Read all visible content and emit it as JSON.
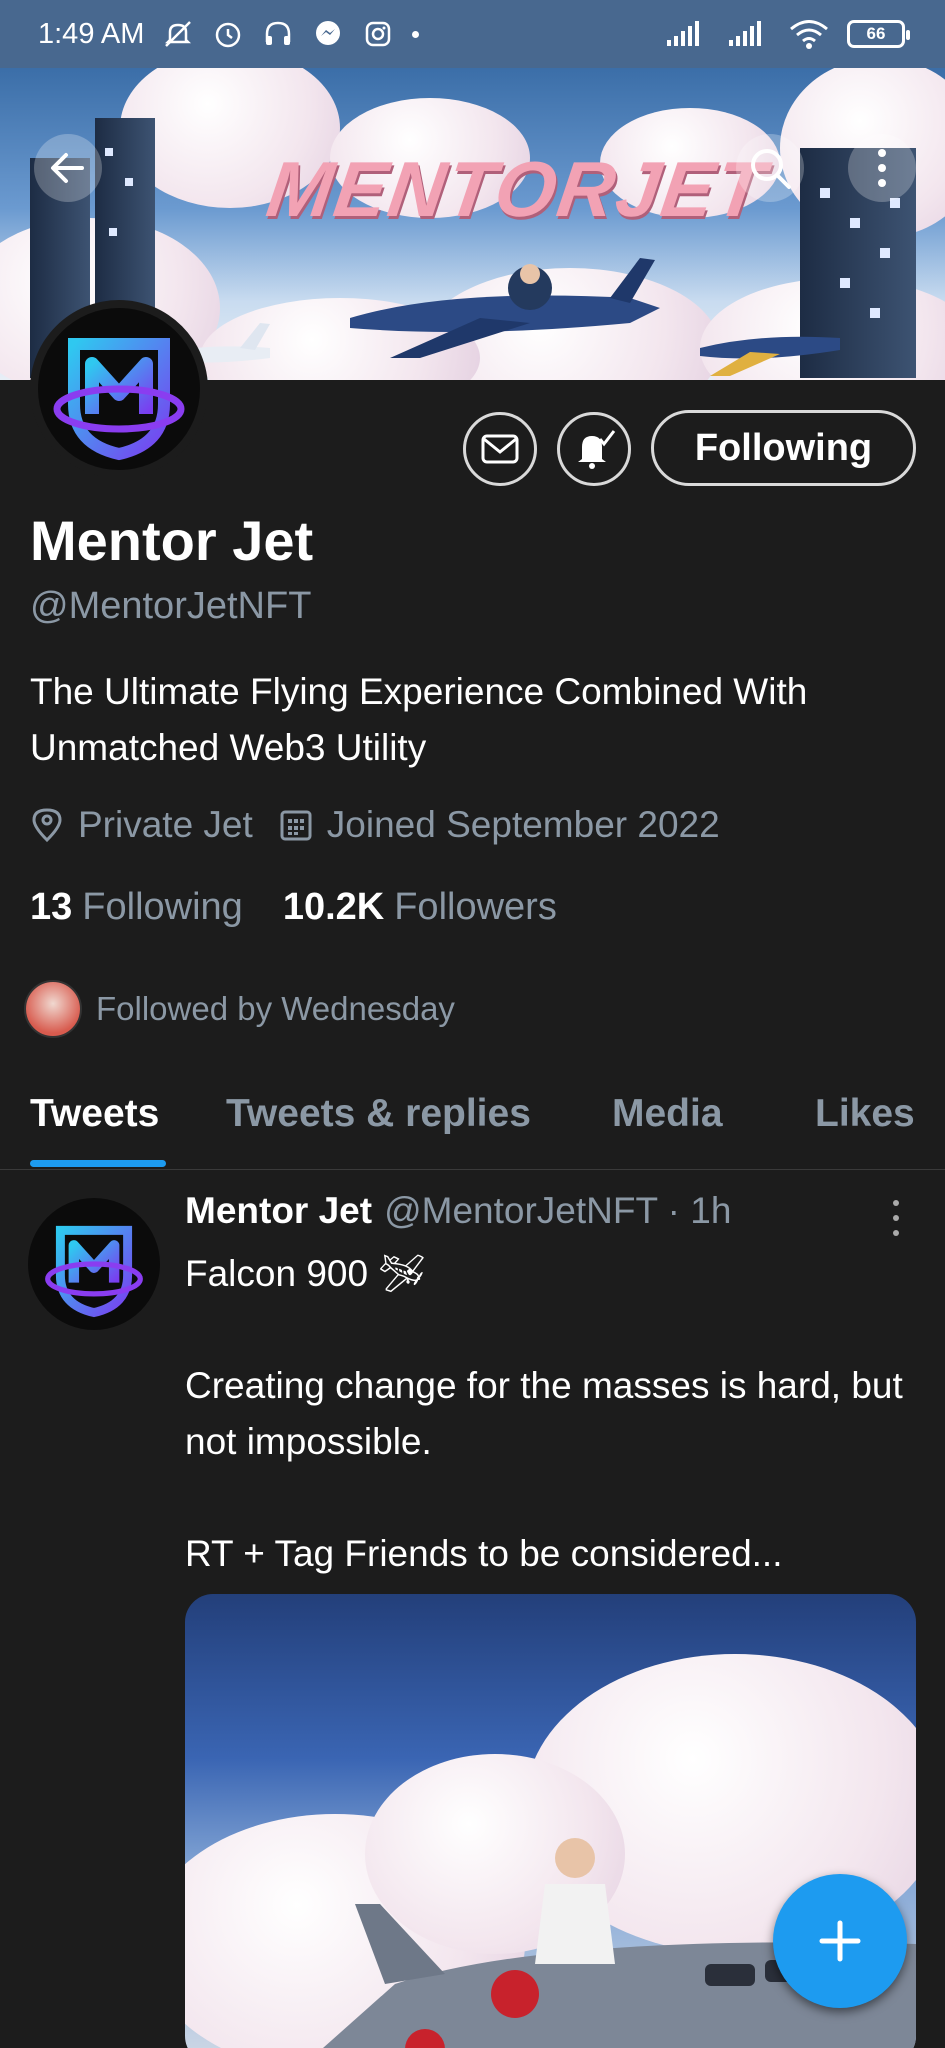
{
  "status_bar": {
    "time": "1:49 AM",
    "battery": "66"
  },
  "banner": {
    "title": "MENTORJET"
  },
  "profile": {
    "name": "Mentor Jet",
    "handle": "@MentorJetNFT",
    "bio": "The Ultimate Flying Experience Combined With Unmatched Web3 Utility",
    "location": "Private Jet",
    "joined": "Joined September 2022",
    "following_count": "13",
    "following_label": "Following",
    "followers_count": "10.2K",
    "followers_label": "Followers",
    "followed_by": "Followed by Wednesday"
  },
  "actions": {
    "follow_state": "Following"
  },
  "tabs": [
    {
      "label": "Tweets",
      "active": true
    },
    {
      "label": "Tweets & replies",
      "active": false
    },
    {
      "label": "Media",
      "active": false
    },
    {
      "label": "Likes",
      "active": false
    }
  ],
  "tweet": {
    "name": "Mentor Jet",
    "handle": "@MentorJetNFT · 1h",
    "text": "Falcon 900 🛩\n\nCreating change for the masses is hard, but not impossible.\n\nRT + Tag Friends to be considered..."
  },
  "colors": {
    "accent": "#1d9bf0",
    "background": "#1c1c1c",
    "secondary_text": "#8b98a5",
    "status_bar": "#48688f"
  }
}
